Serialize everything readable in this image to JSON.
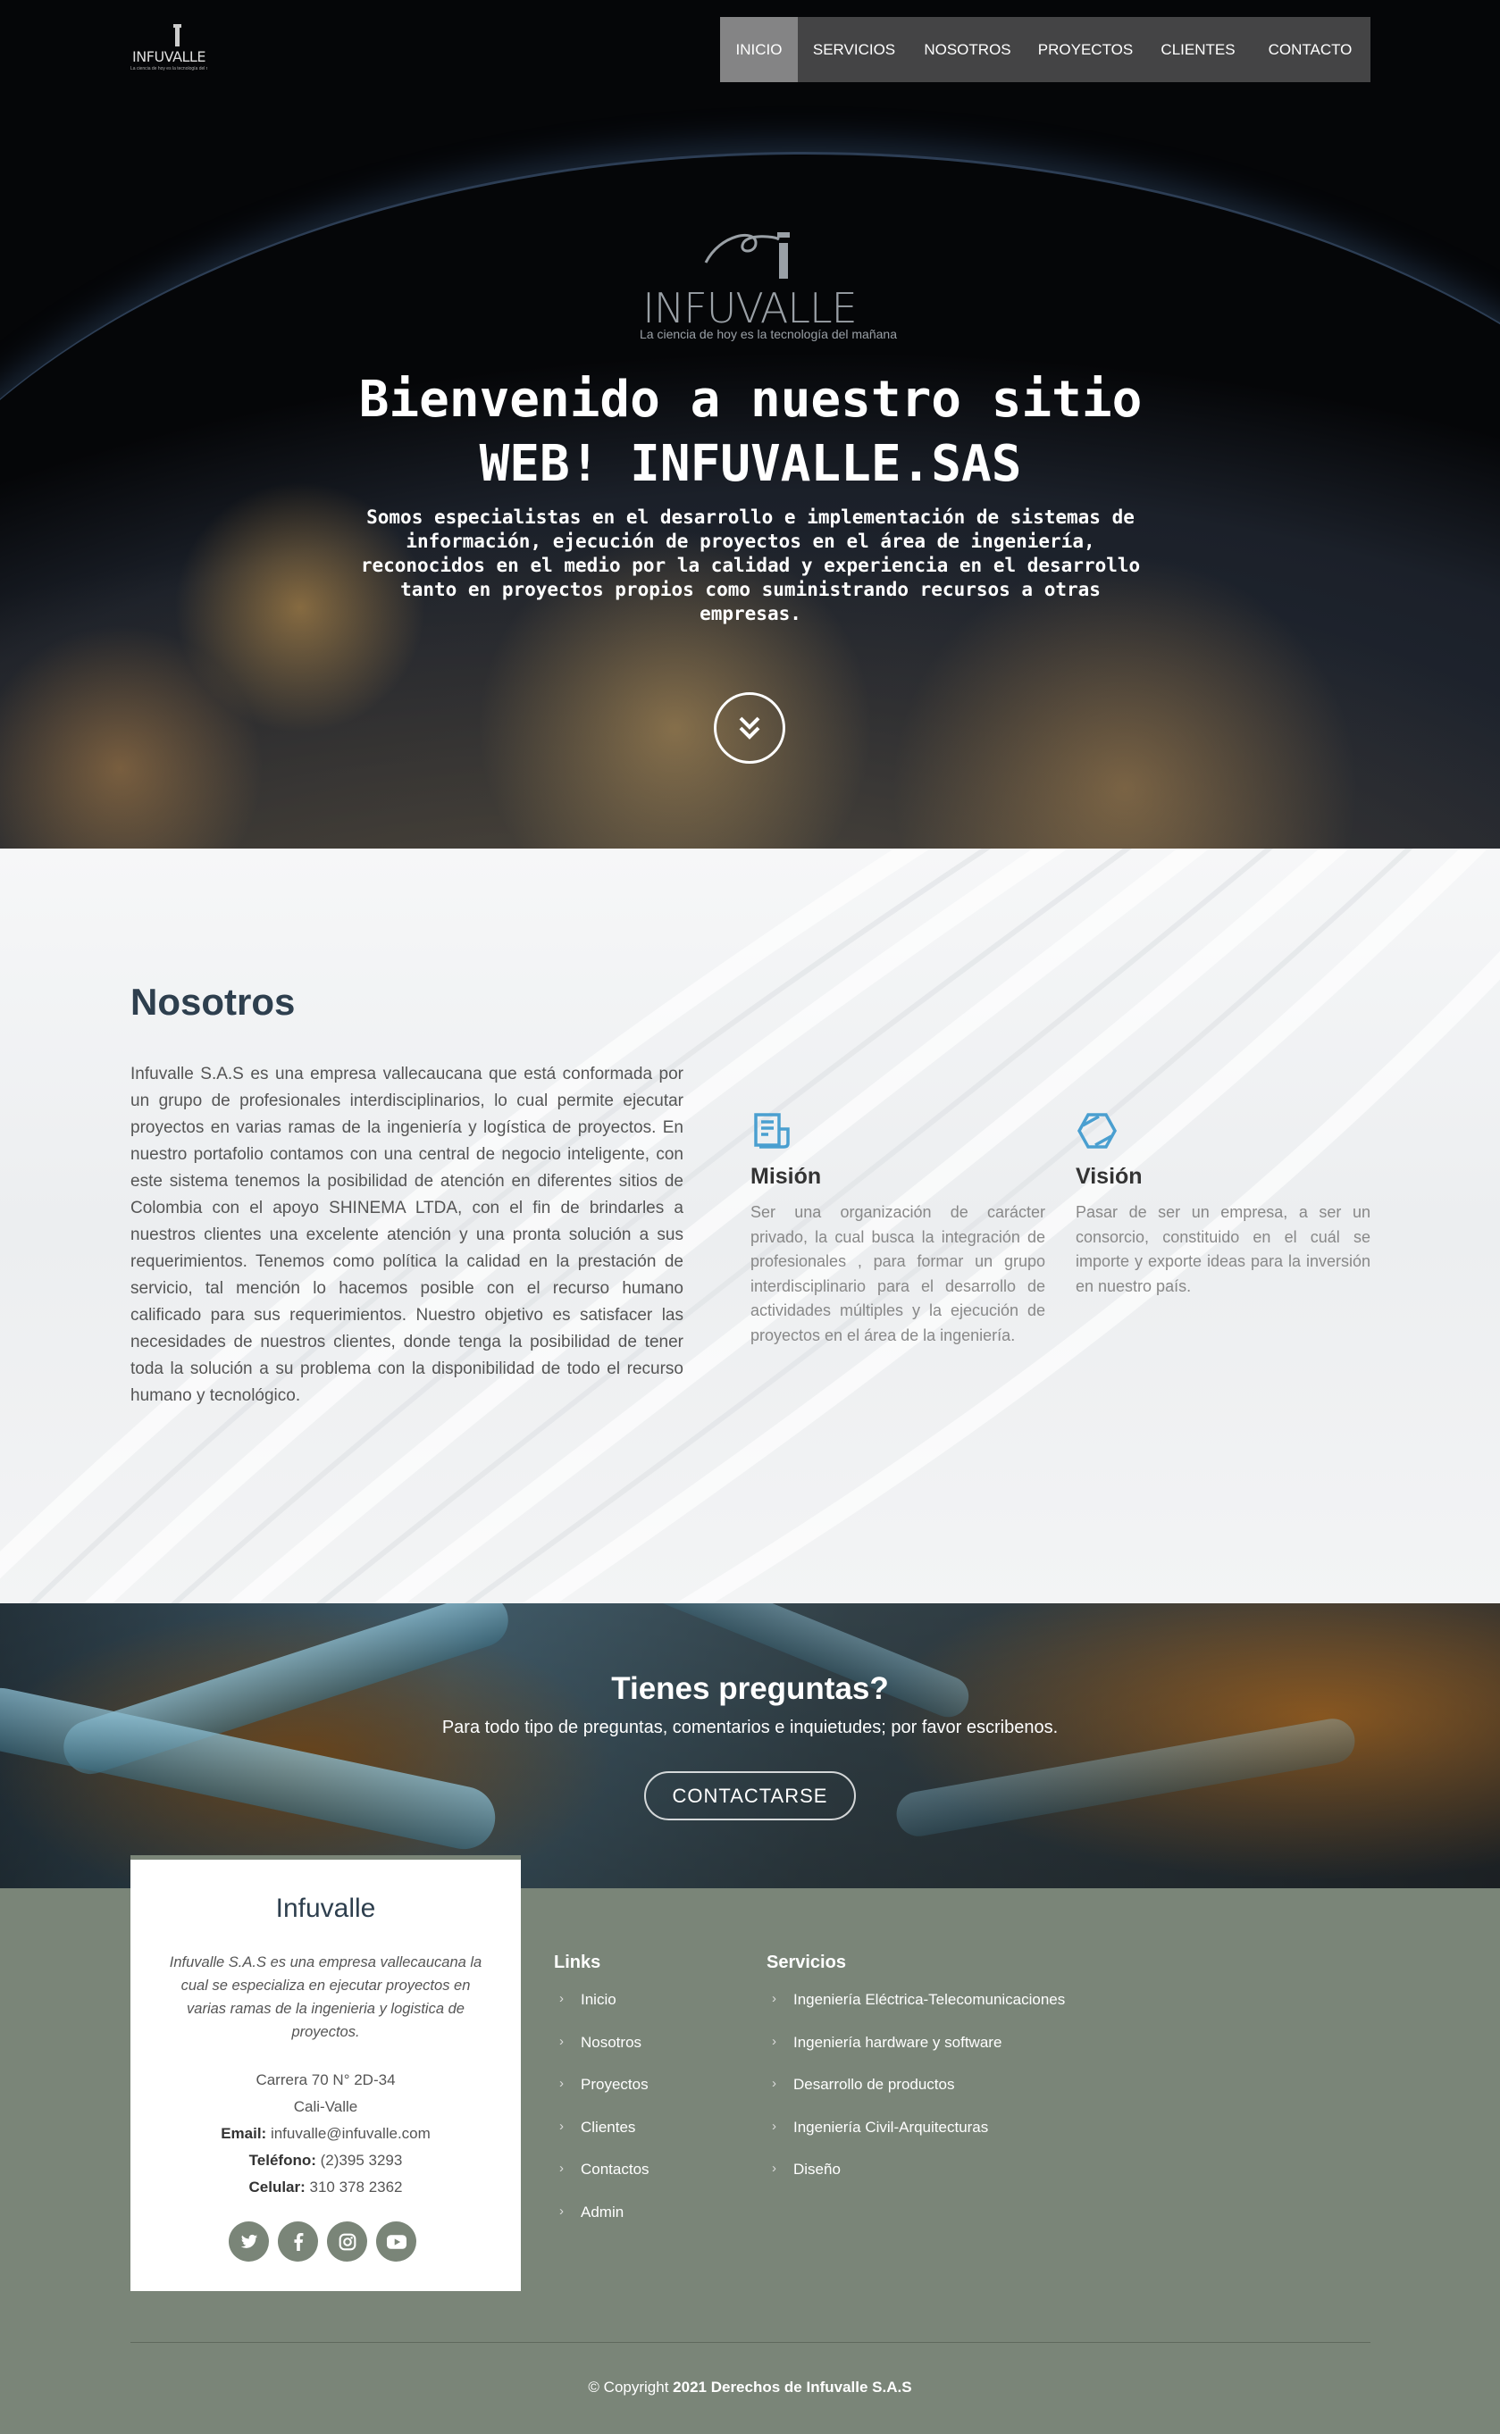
{
  "nav": {
    "logo_text": "INFUVALLE",
    "logo_tagline": "La ciencia de hoy es la tecnología del mañana",
    "items": [
      "INICIO",
      "SERVICIOS",
      "NOSOTROS",
      "PROYECTOS",
      "CLIENTES",
      "CONTACTO"
    ],
    "active": "INICIO"
  },
  "hero": {
    "logo_text": "INFUVALLE",
    "logo_tagline": "La ciencia de hoy es la tecnología del mañana",
    "title_line1": "Bienvenido a nuestro sitio",
    "title_line2": "WEB! INFUVALLE.SAS",
    "subtitle": "Somos especialistas en el desarrollo e implementación de sistemas de información, ejecución de proyectos en el área de ingeniería, reconocidos en el medio por la calidad y experiencia en el desarrollo tanto en proyectos propios como suministrando recursos a otras empresas."
  },
  "about": {
    "title": "Nosotros",
    "body": "Infuvalle S.A.S es una empresa vallecaucana que está conformada por un grupo de profesionales interdisciplinarios, lo cual permite ejecutar proyectos en varias ramas de la ingeniería y logística de proyectos. En nuestro portafolio contamos con una central de negocio inteligente, con este sistema tenemos la posibilidad de atención en diferentes sitios de Colombia con el apoyo SHINEMA LTDA, con el fin de brindarles a nuestros clientes una excelente atención y una pronta solución a sus requerimientos. Tenemos como política la calidad en la prestación de servicio, tal mención lo hacemos posible con el recurso humano calificado para sus requerimientos. Nuestro objetivo es satisfacer las necesidades de nuestros clientes, donde tenga la posibilidad de tener toda la solución a su problema con la disponibilidad de todo el recurso humano y tecnológico.",
    "mision": {
      "title": "Misión",
      "text": "Ser una organización de carácter privado, la cual busca la integración de profesionales , para formar un grupo interdisciplinario para el desarrollo de actividades múltiples y la ejecución de proyectos en el área de la ingeniería."
    },
    "vision": {
      "title": "Visión",
      "text": "Pasar de ser un empresa, a ser un consorcio, constituido en el cuál se importe y exporte ideas para la inversión en nuestro país."
    },
    "accent_color": "#4a9fd0"
  },
  "cta": {
    "title": "Tienes preguntas?",
    "text": "Para todo tipo de preguntas, comentarios e inquietudes; por favor escribenos.",
    "button": "CONTACTARSE"
  },
  "footer": {
    "card_title": "Infuvalle",
    "card_desc": "Infuvalle S.A.S es una empresa vallecaucana la cual se especializa en ejecutar proyectos en varias ramas de la ingenieria y logistica de proyectos.",
    "address1": "Carrera 70 N° 2D-34",
    "address2": "Cali-Valle",
    "email_label": "Email:",
    "email": "infuvalle@infuvalle.com",
    "phone_label": "Teléfono:",
    "phone": "(2)395 3293",
    "cell_label": "Celular:",
    "cell": "310 378 2362",
    "socials": [
      "twitter-icon",
      "facebook-icon",
      "instagram-icon",
      "youtube-icon"
    ],
    "links_title": "Links",
    "links": [
      "Inicio",
      "Nosotros",
      "Proyectos",
      "Clientes",
      "Contactos",
      "Admin"
    ],
    "services_title": "Servicios",
    "services": [
      "Ingeniería Eléctrica-Telecomunicaciones",
      "Ingeniería hardware y software",
      "Desarrollo de productos",
      "Ingeniería Civil-Arquitecturas",
      "Diseño"
    ],
    "copyright_prefix": "© Copyright",
    "copyright_bold": "2021 Derechos de Infuvalle S.A.S",
    "bg_color": "#7a8578"
  }
}
